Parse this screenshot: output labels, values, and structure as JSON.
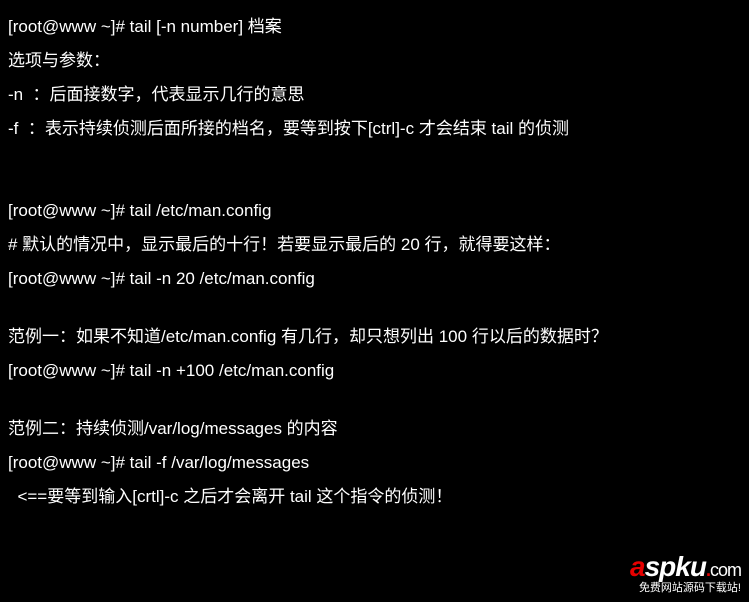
{
  "terminal": {
    "lines": [
      "[root@www ~]# tail [-n number] 档案",
      "选项与参数：",
      "-n  ：后面接数字，代表显示几行的意思",
      "-f  ：表示持续侦测后面所接的档名，要等到按下[ctrl]-c 才会结束 tail 的侦测",
      "",
      "",
      "[root@www ~]# tail /etc/man.config",
      "# 默认的情况中，显示最后的十行！若要显示最后的 20 行，就得要这样：",
      "[root@www ~]# tail -n 20 /etc/man.config",
      "",
      "范例一：如果不知道/etc/man.config 有几行，却只想列出 100 行以后的数据时？",
      "[root@www ~]# tail -n +100 /etc/man.config",
      "",
      "范例二：持续侦测/var/log/messages 的内容",
      "[root@www ~]# tail -f /var/log/messages",
      "  <==要等到输入[crtl]-c 之后才会离开 tail 这个指令的侦测！"
    ]
  },
  "watermark": {
    "brand_a": "a",
    "brand_spku": "spku",
    "brand_dot": ".",
    "brand_com": "com",
    "tagline": "免费网站源码下载站!"
  }
}
